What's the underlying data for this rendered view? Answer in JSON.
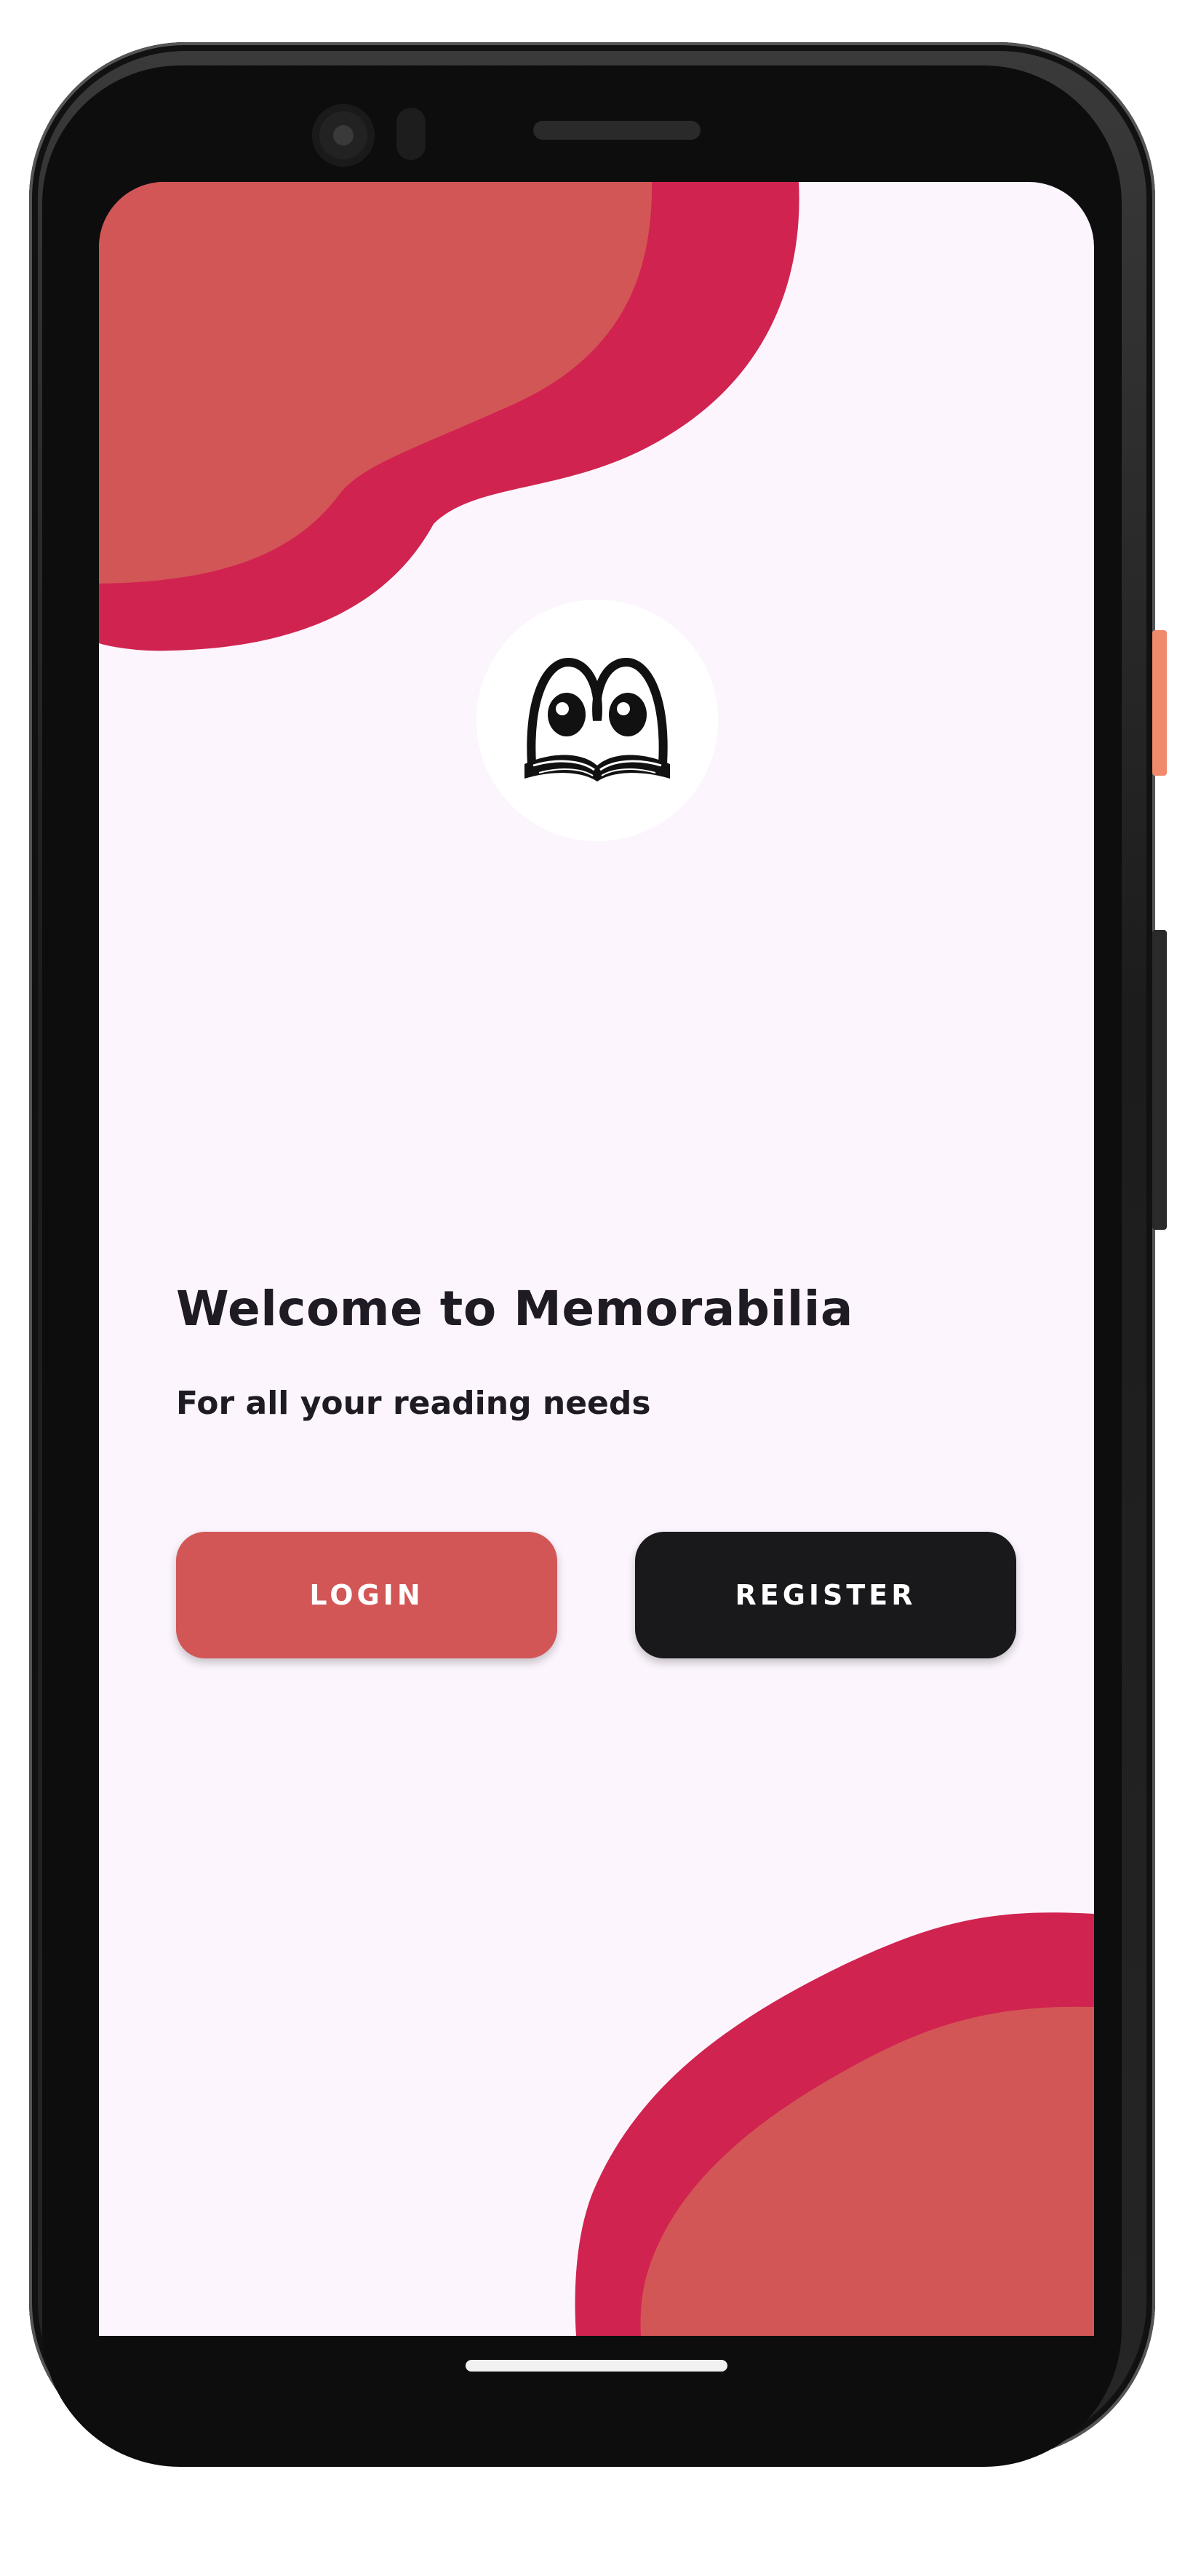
{
  "app": {
    "name": "Memorabilia"
  },
  "welcome": {
    "title": "Welcome to Memorabilia",
    "subtitle": "For all your reading needs"
  },
  "buttons": {
    "login_label": "LOGIN",
    "register_label": "REGISTER"
  },
  "logo": {
    "icon": "book-eyes-logo-icon"
  },
  "colors": {
    "background": "#fcf5fd",
    "blob_outer": "#d0234f",
    "blob_inner": "#d35656",
    "login_button": "#d35656",
    "register_button": "#19191c",
    "text_primary": "#1f1b24"
  }
}
